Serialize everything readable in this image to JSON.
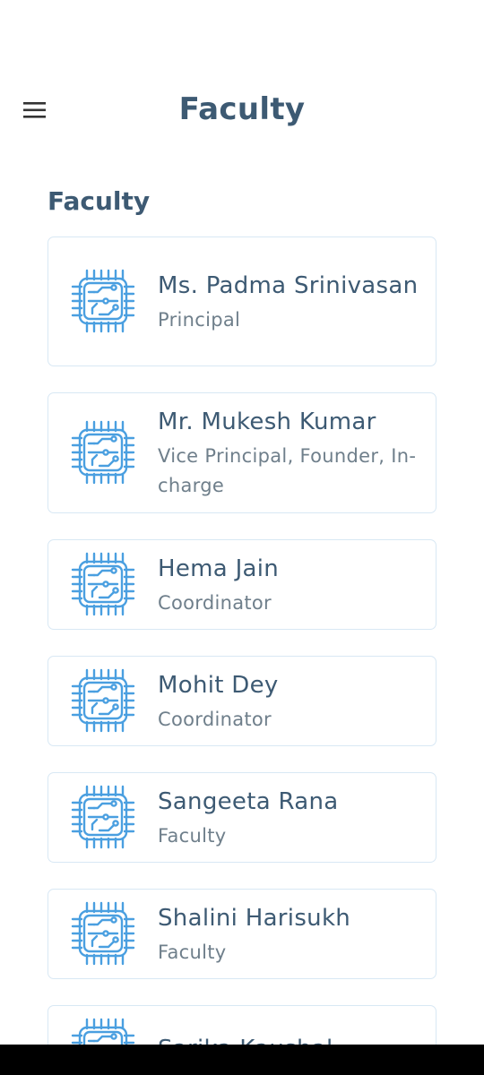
{
  "header": {
    "title": "Faculty",
    "menu_icon": "hamburger-menu-icon"
  },
  "section": {
    "title": "Faculty"
  },
  "avatar_icon": "circuit-chip-icon",
  "colors": {
    "heading": "#3d5a73",
    "subtitle": "#6f7f8b",
    "card_border": "#d8e8f4",
    "icon": "#4a9fe0"
  },
  "faculty": [
    {
      "name": "Ms. Padma Srinivasan",
      "role": "Principal"
    },
    {
      "name": "Mr. Mukesh Kumar",
      "role": "Vice Principal, Founder, In-charge"
    },
    {
      "name": "Hema Jain",
      "role": "Coordinator"
    },
    {
      "name": "Mohit Dey",
      "role": "Coordinator"
    },
    {
      "name": "Sangeeta Rana",
      "role": "Faculty"
    },
    {
      "name": "Shalini Harisukh",
      "role": "Faculty"
    },
    {
      "name": "Sarika Kaushal",
      "role": ""
    }
  ]
}
